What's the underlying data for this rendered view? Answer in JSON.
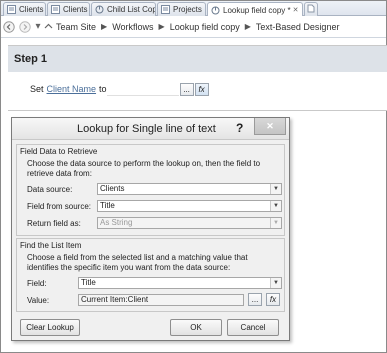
{
  "tabs": [
    {
      "label": "Clients",
      "icon": "list-icon"
    },
    {
      "label": "Clients",
      "icon": "list-icon"
    },
    {
      "label": "Child List Copy",
      "icon": "workflow-icon"
    },
    {
      "label": "Projects",
      "icon": "list-icon"
    },
    {
      "label": "Lookup field copy *",
      "icon": "workflow-icon",
      "active": true
    }
  ],
  "breadcrumb": [
    "Team Site",
    "Workflows",
    "Lookup field copy",
    "Text-Based Designer"
  ],
  "step": {
    "title": "Step 1",
    "set_label": "Set",
    "field_link": "Client Name",
    "to_label": "to",
    "ellipsis": "...",
    "fx": "fx"
  },
  "dialog": {
    "title": "Lookup for Single line of text",
    "help": "?",
    "retrieve": {
      "title": "Field Data to Retrieve",
      "description": "Choose the data source to perform the lookup on, then the field to retrieve data from:",
      "data_source_label": "Data source:",
      "data_source_value": "Clients",
      "field_from_source_label": "Field from source:",
      "field_from_source_value": "Title",
      "return_field_label": "Return field as:",
      "return_field_value": "As String"
    },
    "find": {
      "title": "Find the List Item",
      "description": "Choose a field from the selected list and a matching value that identifies the specific item you want from the data source:",
      "field_label": "Field:",
      "field_value": "Title",
      "value_label": "Value:",
      "value_value": "Current Item:Client"
    },
    "buttons": {
      "clear": "Clear Lookup",
      "ok": "OK",
      "cancel": "Cancel"
    }
  },
  "colors": {
    "link": "#4b6f9a",
    "step_header_bg": "#dde2e8",
    "dialog_bg": "#f0f0f0"
  }
}
